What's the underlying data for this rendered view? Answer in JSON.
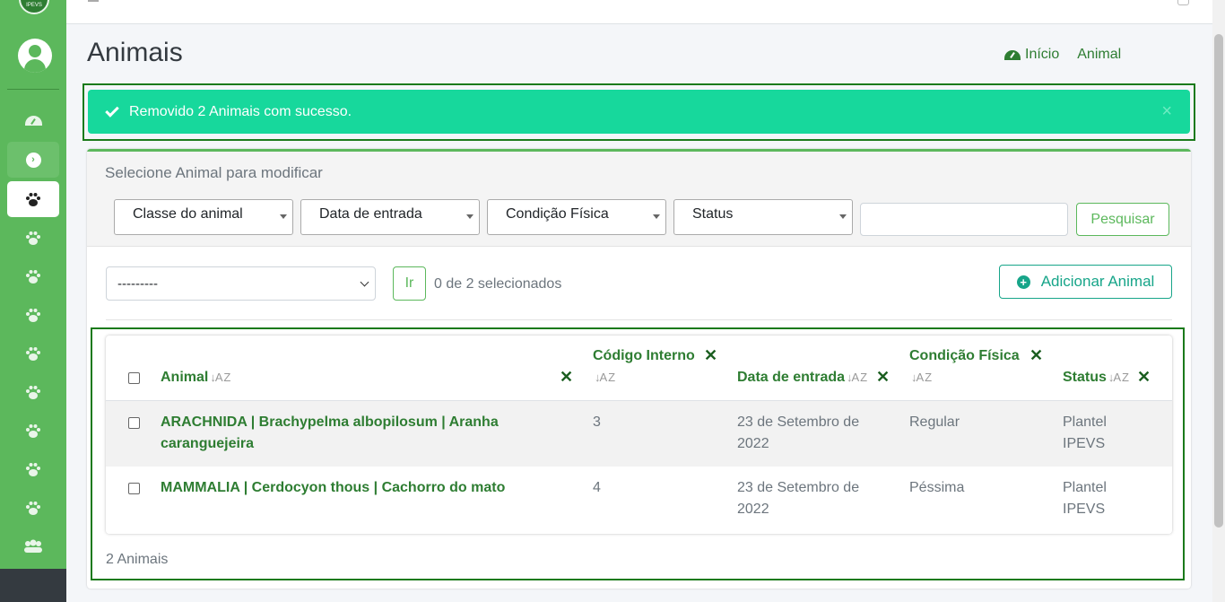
{
  "sidebar": {
    "logo_text": "IPEVS",
    "items": [
      {
        "icon": "gauge-icon"
      },
      {
        "icon": "circle-arrow-icon"
      },
      {
        "icon": "paw-icon"
      },
      {
        "icon": "paw-icon"
      },
      {
        "icon": "paw-icon"
      },
      {
        "icon": "paw-icon"
      },
      {
        "icon": "paw-icon"
      },
      {
        "icon": "paw-icon"
      },
      {
        "icon": "paw-icon"
      },
      {
        "icon": "paw-icon"
      },
      {
        "icon": "paw-icon"
      },
      {
        "icon": "users-cog-icon"
      }
    ]
  },
  "header": {
    "title": "Animais",
    "breadcrumb": {
      "home": "Início",
      "current": "Animal"
    }
  },
  "alert": {
    "message": "Removido 2 Animais com sucesso.",
    "close": "×"
  },
  "card": {
    "title": "Selecione Animal para modificar",
    "filters": [
      "Classe do animal",
      "Data de entrada",
      "Condição Física",
      "Status"
    ],
    "search_value": "",
    "search_button": "Pesquisar",
    "action_select_value": "---------",
    "go_button": "Ir",
    "selected_count": "0 de 2 selecionados",
    "add_button": "Adicionar Animal",
    "footer_count": "2 Animais"
  },
  "table": {
    "columns": {
      "animal": "Animal",
      "codigo_line1": "Código Interno",
      "data_entrada": "Data de entrada",
      "condicao_line1": "Condição Física",
      "status": "Status"
    },
    "rows": [
      {
        "animal_line1": "ARACHNIDA | Brachypelma albopilosum | Aranha",
        "animal_line2": "caranguejeira",
        "codigo": "3",
        "data_line1": "23 de Setembro de",
        "data_line2": "2022",
        "condicao": "Regular",
        "status_line1": "Plantel",
        "status_line2": "IPEVS"
      },
      {
        "animal_line1": "MAMMALIA | Cerdocyon thous | Cachorro do mato",
        "animal_line2": "",
        "codigo": "4",
        "data_line1": "23 de Setembro de",
        "data_line2": "2022",
        "condicao": "Péssima",
        "status_line1": "Plantel",
        "status_line2": "IPEVS"
      }
    ]
  },
  "colors": {
    "sidebar_green": "#5cb85c",
    "link_green": "#2e7d32",
    "alert_bg": "#17d89c",
    "teal_button": "#17a589"
  }
}
